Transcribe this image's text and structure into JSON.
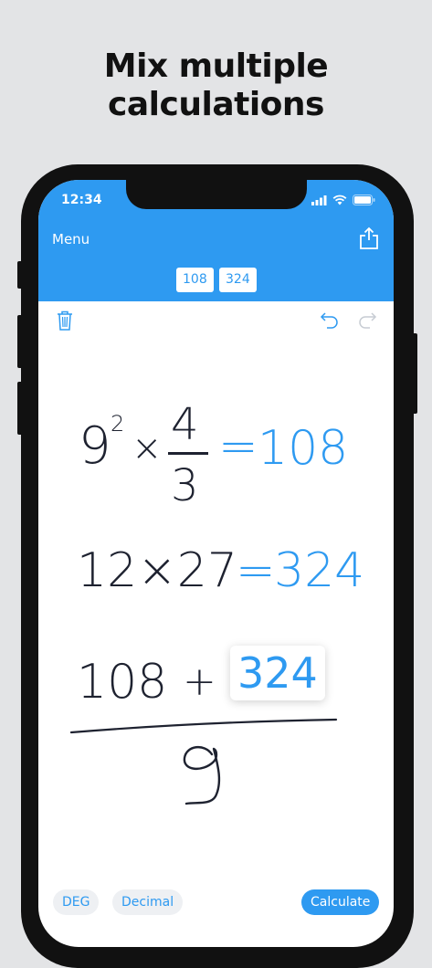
{
  "headline": {
    "line1": "Mix multiple",
    "line2": "calculations"
  },
  "status": {
    "time": "12:34"
  },
  "header": {
    "menu_label": "Menu",
    "chips": [
      "108",
      "324"
    ]
  },
  "expressions": {
    "e1": {
      "base": "9",
      "exponent": "2",
      "times": "×",
      "numerator": "4",
      "denominator": "3",
      "equals": "=",
      "result": "108"
    },
    "e2": {
      "lhs": "12×27",
      "equals": "=",
      "result": "324"
    },
    "e3": {
      "lhs": "108",
      "plus": "+",
      "operand_result": "324",
      "divisor": "9"
    }
  },
  "bottom": {
    "deg_label": "DEG",
    "decimal_label": "Decimal",
    "calculate_label": "Calculate"
  },
  "colors": {
    "accent": "#2e9af1",
    "ink": "#1e2230",
    "background": "#e3e4e6"
  },
  "icons": [
    "signal-icon",
    "wifi-icon",
    "battery-icon",
    "share-icon",
    "trash-icon",
    "undo-icon",
    "redo-icon"
  ]
}
